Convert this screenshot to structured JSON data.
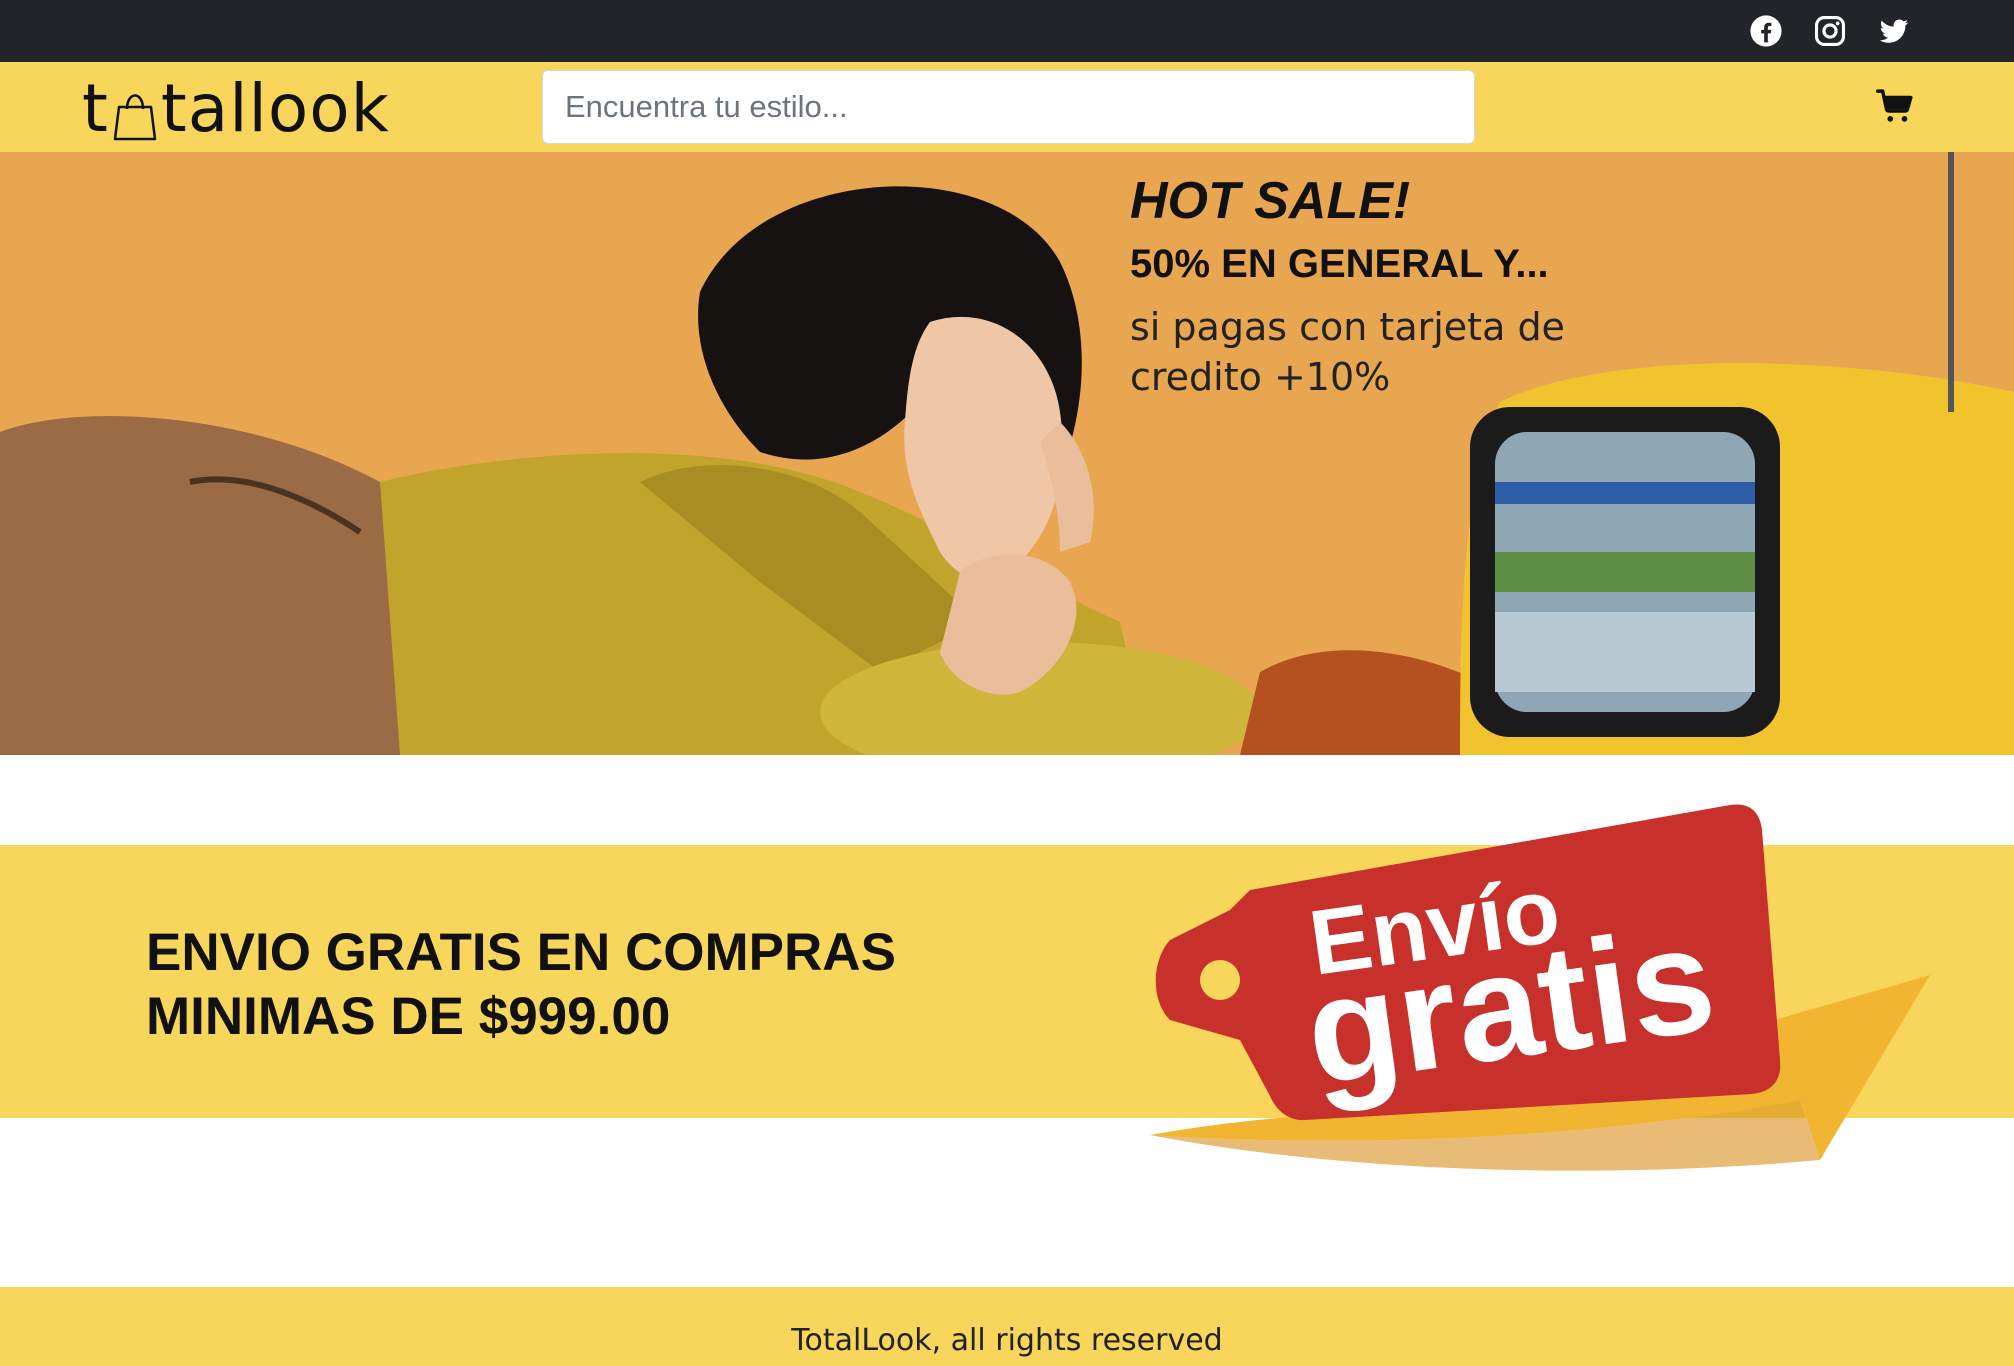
{
  "social": {
    "facebook_icon": "facebook-icon",
    "instagram_icon": "instagram-icon",
    "twitter_icon": "twitter-icon"
  },
  "header": {
    "logo_prefix": "t",
    "logo_suffix": "tallook",
    "search_placeholder": "Encuentra tu estilo...",
    "cart_icon": "cart-icon"
  },
  "hero": {
    "title": "HOT SALE!",
    "subtitle": "50% EN GENERAL Y...",
    "description": "si pagas con tarjeta de credito +10%"
  },
  "shipping": {
    "text": "ENVIO GRATIS EN COMPRAS MINIMAS DE $999.00",
    "tag_line1": "Envío",
    "tag_line2": "gratis"
  },
  "footer": {
    "text": "TotalLook, all rights reserved"
  },
  "colors": {
    "topbar": "#212529",
    "brand_yellow": "#f8d65b",
    "hero_bg": "#e9a651",
    "tag_red": "#c8302c"
  }
}
